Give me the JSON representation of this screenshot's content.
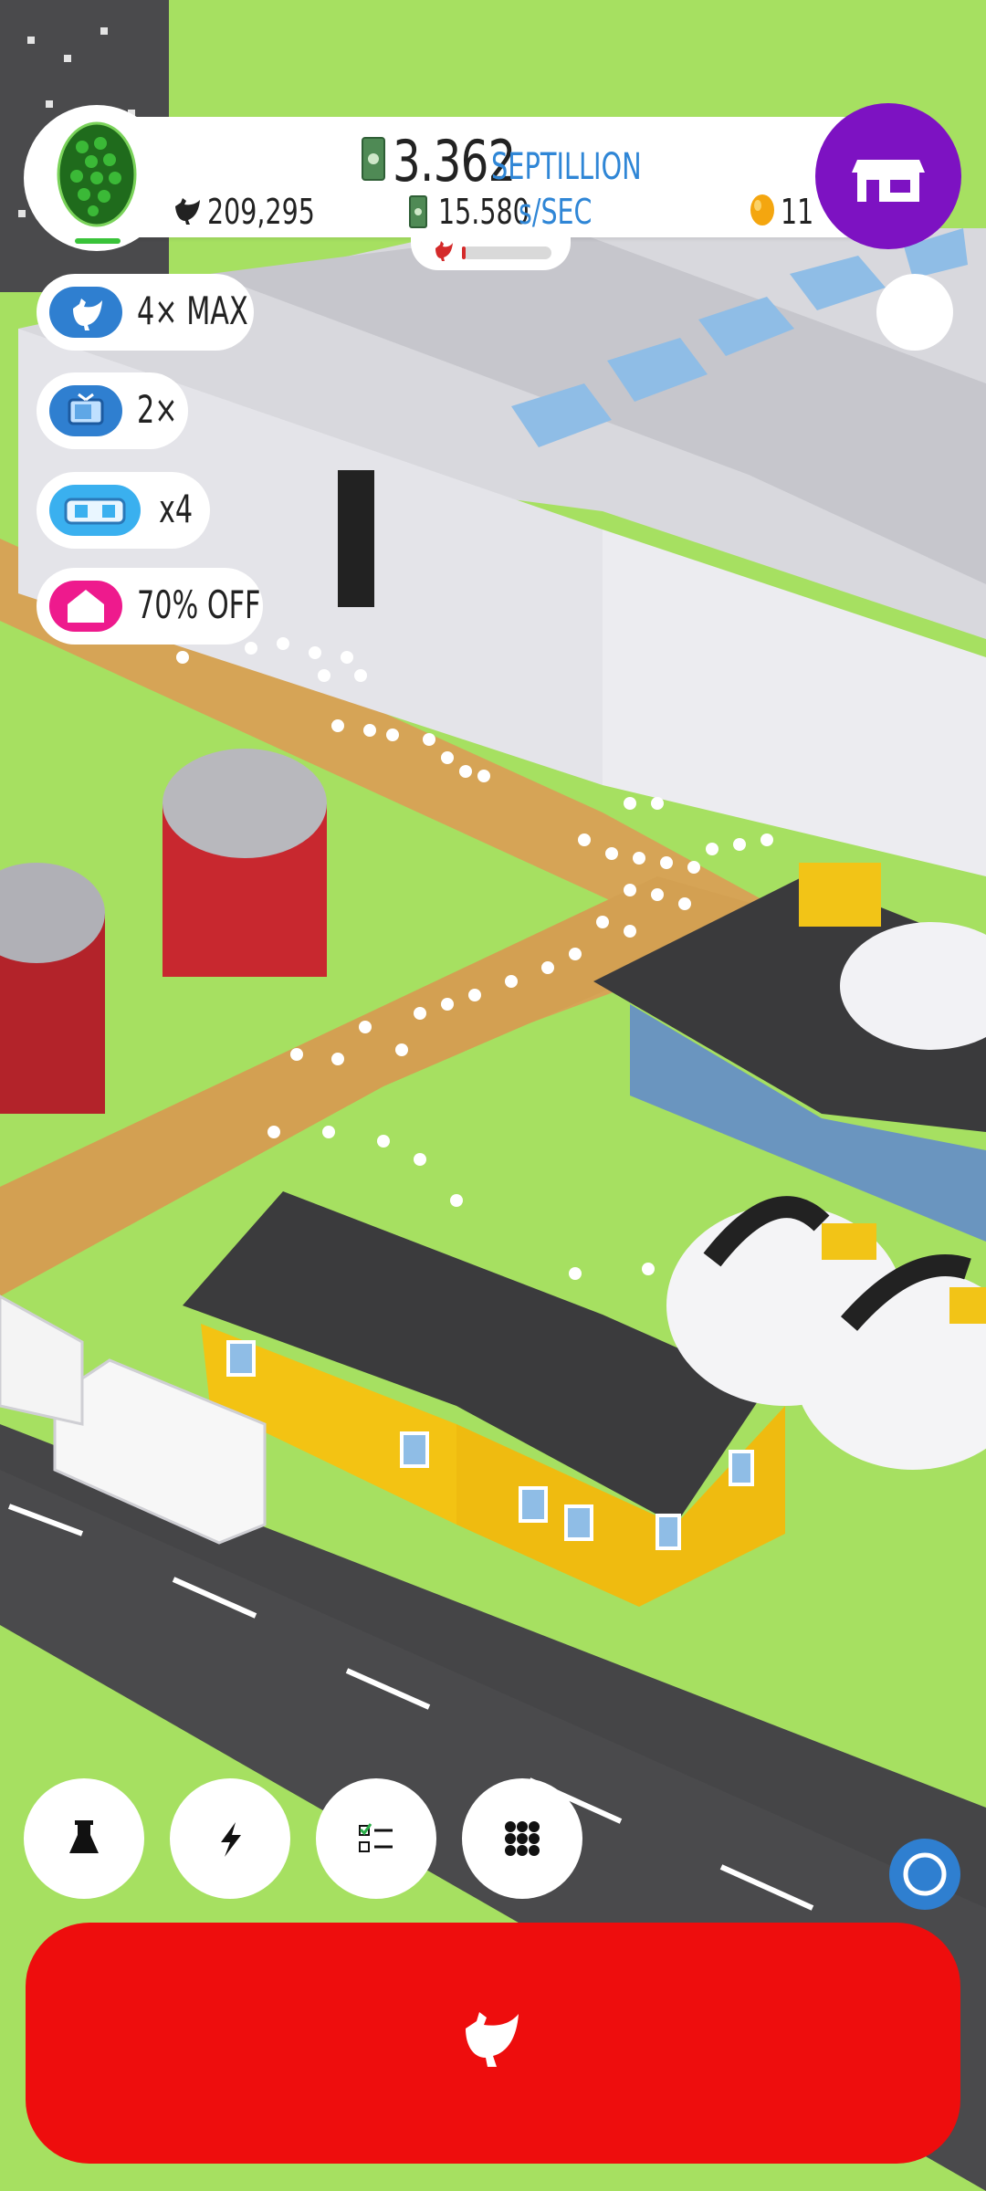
{
  "header": {
    "egg_icon": "green-hex-egg-icon",
    "money_value": "3.362",
    "money_unit": "SEPTILLION",
    "chicken_count": "209,295",
    "rate_value": "15.580",
    "rate_unit": "s/SEC",
    "golden_eggs": "11",
    "shop_icon": "shop-icon"
  },
  "boosts": [
    {
      "label": "4× MAX",
      "icon": "chicken-icon",
      "color": "#2f7fd0"
    },
    {
      "label": "2×",
      "icon": "video-icon",
      "color": "#2f7fd0"
    },
    {
      "label": "x4",
      "icon": "game-controller-icon",
      "color": "#3ab0ef"
    },
    {
      "label": "70% OFF",
      "icon": "house-icon",
      "color": "#ee1a8d"
    }
  ],
  "bottom_buttons": [
    {
      "name": "research",
      "icon": "flask-icon"
    },
    {
      "name": "boosts",
      "icon": "lightning-icon"
    },
    {
      "name": "missions",
      "icon": "checklist-icon"
    },
    {
      "name": "menu",
      "icon": "grid-icon"
    }
  ],
  "hatch_button": {
    "icon": "chicken-icon",
    "color": "#ee0d0d"
  },
  "colors": {
    "grass": "#a6e061",
    "road": "#4a4a4c",
    "path": "#d6a456",
    "shop": "#7d12c2"
  }
}
